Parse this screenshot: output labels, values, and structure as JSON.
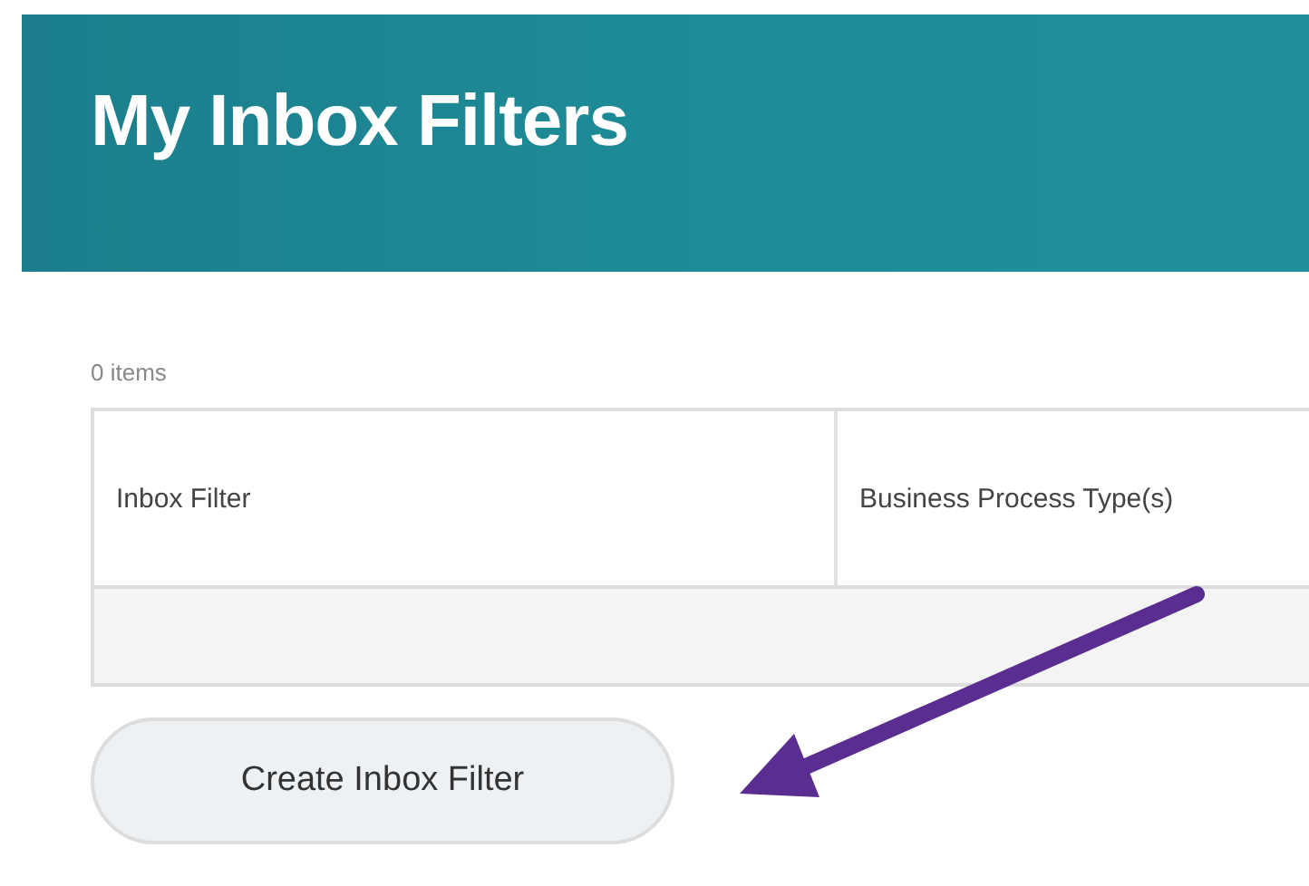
{
  "header": {
    "title": "My Inbox Filters"
  },
  "table": {
    "count": "0 items",
    "columns": [
      "Inbox Filter",
      "Business Process Type(s)"
    ]
  },
  "buttons": [
    {
      "label": "Create Inbox Filter"
    }
  ]
}
